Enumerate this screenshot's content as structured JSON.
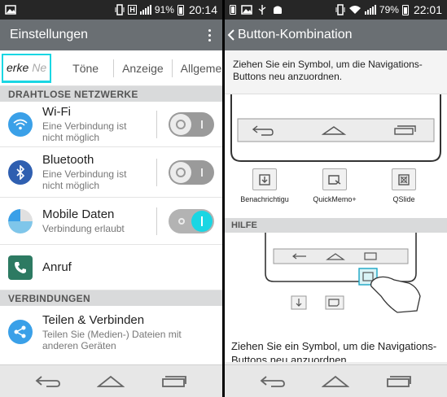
{
  "left": {
    "status": {
      "battery": "91%",
      "time": "20:14",
      "network_badge": "H"
    },
    "title": "Einstellungen",
    "tabs": [
      "erke",
      "Ne",
      "Töne",
      "Anzeige",
      "Allgeme"
    ],
    "sections": [
      {
        "header": "DRAHTLOSE NETZWERKE"
      },
      {
        "header": "VERBINDUNGEN"
      }
    ],
    "rows": [
      {
        "title": "Wi-Fi",
        "subtitle": "Eine Verbindung ist nicht möglich",
        "toggle": false,
        "icon": "wifi-icon"
      },
      {
        "title": "Bluetooth",
        "subtitle": "Eine Verbindung ist nicht möglich",
        "toggle": false,
        "icon": "bluetooth-icon"
      },
      {
        "title": "Mobile Daten",
        "subtitle": "Verbindung erlaubt",
        "toggle": true,
        "icon": "mobile-data-icon"
      },
      {
        "title": "Anruf",
        "subtitle": "",
        "icon": "phone-icon"
      },
      {
        "title": "Teilen & Verbinden",
        "subtitle": "Teilen Sie (Medien-) Dateien mit anderen Geräten",
        "icon": "share-icon"
      }
    ]
  },
  "right": {
    "status": {
      "battery": "79%",
      "time": "22:01"
    },
    "title": "Button-Kombination",
    "hint": "Ziehen Sie ein Symbol, um die Navigations-Buttons neu anzuordnen.",
    "options": [
      {
        "label": "Benachrichtigu",
        "icon": "notification-icon"
      },
      {
        "label": "QuickMemo+",
        "icon": "quickmemo-icon"
      },
      {
        "label": "QSlide",
        "icon": "qslide-icon"
      }
    ],
    "help_header": "HILFE",
    "help_text": "Ziehen Sie ein Symbol, um die Navigations-Buttons neu anzuordnen."
  },
  "colors": {
    "titlebar": "#6a6f73",
    "accent": "#1ad6e3",
    "wifi": "#3aa0e8",
    "bluetooth": "#2f5fb0",
    "phone": "#2d7a62",
    "share": "#3aa0e8"
  }
}
